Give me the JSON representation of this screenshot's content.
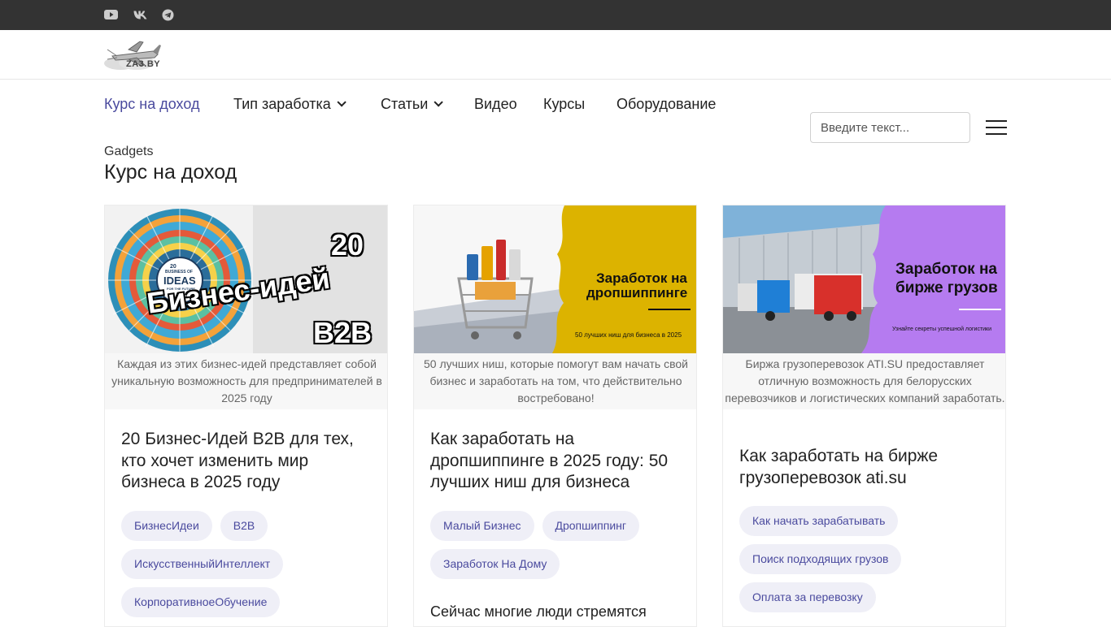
{
  "topbar": {
    "social": [
      {
        "name": "youtube-icon"
      },
      {
        "name": "vk-icon"
      },
      {
        "name": "telegram-icon"
      }
    ]
  },
  "logo": {
    "text": "ZA3.BY"
  },
  "nav": {
    "items": [
      {
        "label": "Курс на доход",
        "active": true
      },
      {
        "label": "Тип заработка",
        "dropdown": true
      },
      {
        "label": "Статьи",
        "dropdown": true
      },
      {
        "label": "Видео"
      },
      {
        "label": "Курсы"
      },
      {
        "label": "Оборудование"
      }
    ],
    "search_placeholder": "Введите текст..."
  },
  "breadcrumb": "Gadgets",
  "page_title": "Курс на доход",
  "colors": {
    "accent": "#4a4a9e",
    "topbar": "#333333",
    "tag_bg": "#efeff7"
  },
  "cards": [
    {
      "image": {
        "line1": "20",
        "line2": "Бизнес-идей",
        "line3": "B2B",
        "center_top": "20",
        "center_main": "IDEAS",
        "center_sub": "BUSINESS OF",
        "center_foot": "FOR THE FUTURE"
      },
      "caption": "Каждая из этих бизнес-идей представляет собой уникальную возможность для предпринимателей в 2025 году",
      "title": "20 Бизнес-Идей B2B для тех, кто хочет изменить мир бизнеса в 2025 году",
      "tags": [
        "БизнесИдеи",
        "B2B",
        "ИскусственныйИнтеллект",
        "КорпоративноеОбучение"
      ]
    },
    {
      "image": {
        "headline1": "Заработок на",
        "headline2": "дропшиппинге",
        "sub": "50 лучших ниш для бизнеса в 2025"
      },
      "caption": "50 лучших ниш, которые помогут вам начать свой бизнес и заработать на том, что действительно востребовано!",
      "title": "Как заработать на дропшиппинге в 2025 году: 50 лучших ниш для бизнеса",
      "tags": [
        "Малый Бизнес",
        "Дропшиппинг",
        "Заработок На Дому"
      ],
      "excerpt": "Сейчас многие люди стремятся"
    },
    {
      "image": {
        "headline1": "Заработок на",
        "headline2": "бирже грузов",
        "sub": "Узнайте секреты успешной логистики"
      },
      "caption": "Биржа грузоперевозок ATI.SU предоставляет отличную возможность для белорусских перевозчиков и логистических компаний заработать.",
      "title": "Как заработать на бирже грузоперевозок ati.su",
      "tags": [
        "Как начать зарабатывать",
        "Поиск подходящих грузов",
        "Оплата за перевозку"
      ]
    }
  ]
}
